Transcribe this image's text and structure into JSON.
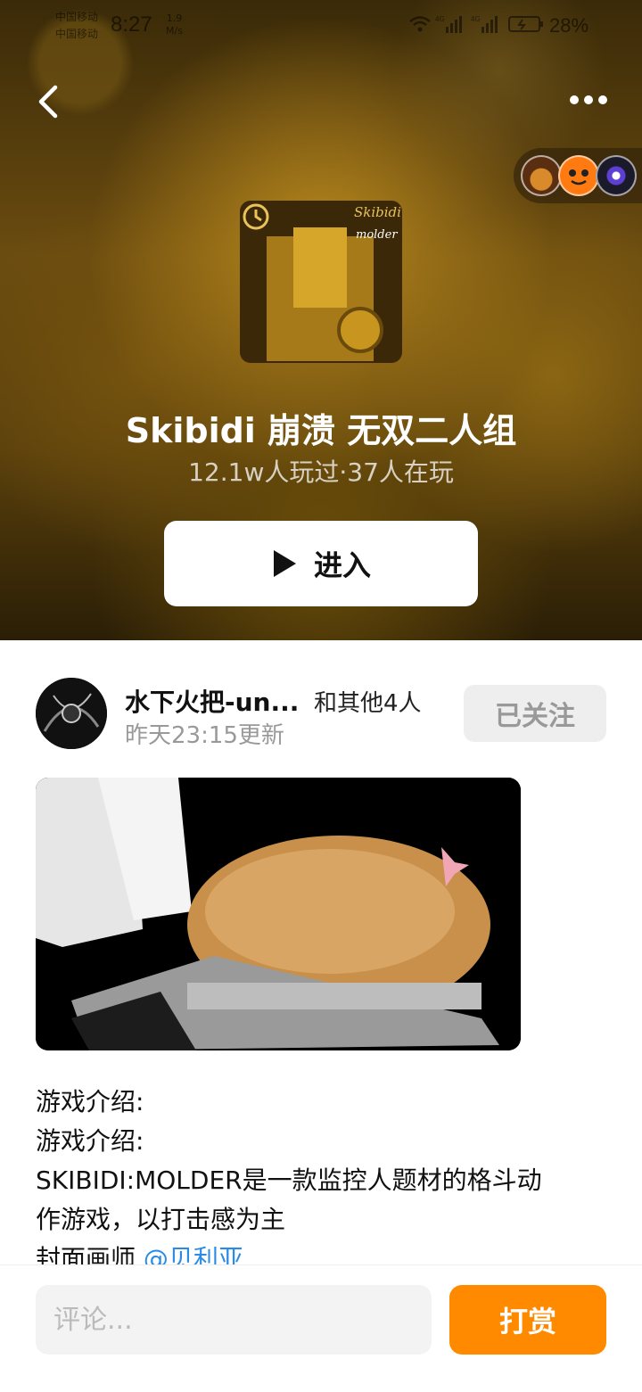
{
  "status_bar": {
    "carrier_1": "中国移动",
    "carrier_2": "中国移动",
    "time": "8:27",
    "speed_value": "1.9",
    "speed_unit": "M/s",
    "network_1": "4G",
    "network_2": "4G",
    "battery": "28%"
  },
  "game": {
    "title": "Skibidi 崩溃 无双二人组",
    "stats": "12.1w人玩过·37人在玩",
    "cover_text_1": "Skibidi",
    "cover_text_2": "molder",
    "enter_label": "进入"
  },
  "post": {
    "author_name": "水下火把-un...",
    "others": "和其他4人",
    "updated": "昨天23:15更新",
    "follow_label": "已关注",
    "description_lines": [
      "游戏介绍:",
      "游戏介绍:",
      "SKIBIDI:MOLDER是一款监控人题材的格斗动",
      "作游戏，以打击感为主"
    ],
    "cover_artist_label": "封面画师",
    "cover_artist_mention": "@贝利亚"
  },
  "bottom_bar": {
    "comment_placeholder": "评论...",
    "tip_label": "打赏"
  },
  "colors": {
    "accent": "#ff8a00",
    "mention": "#2a8be6"
  }
}
